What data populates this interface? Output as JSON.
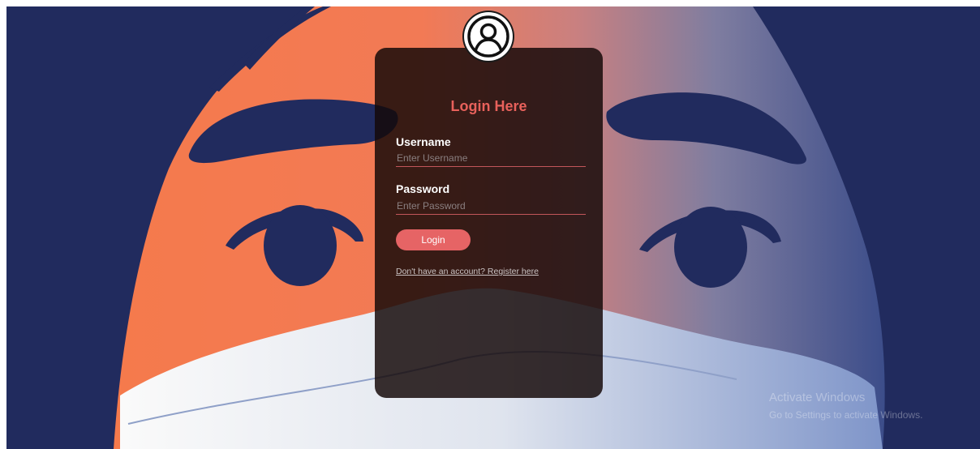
{
  "login": {
    "title": "Login Here",
    "username_label": "Username",
    "username_placeholder": "Enter Username",
    "username_value": "",
    "password_label": "Password",
    "password_placeholder": "Enter Password",
    "password_value": "",
    "button_label": "Login",
    "register_link": "Don't have an account? Register here"
  },
  "watermark": {
    "line1": "Activate Windows",
    "line2": "Go to Settings to activate Windows."
  },
  "colors": {
    "background": "#212b5e",
    "orange": "#f57a4c",
    "accent": "#e66465",
    "card": "#140808"
  },
  "icons": {
    "avatar": "user-circle-icon"
  }
}
